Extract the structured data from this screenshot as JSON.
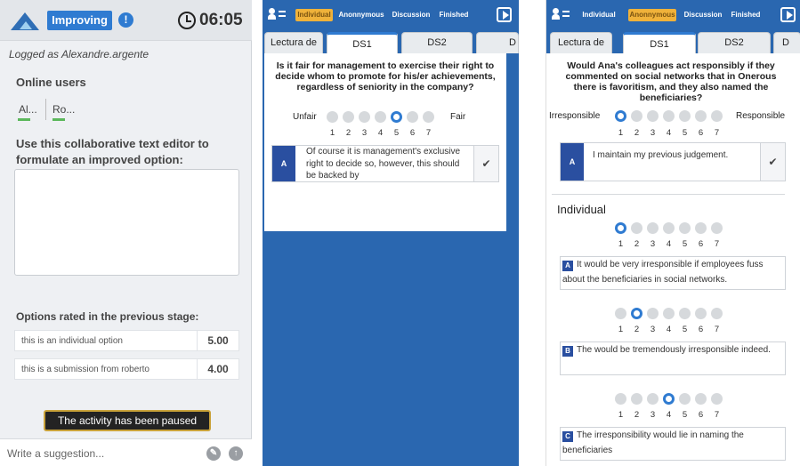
{
  "panel1": {
    "status_badge": "Improving",
    "info_glyph": "!",
    "timer": "06:05",
    "logged_as": "Logged as Alexandre.argente",
    "online_users_title": "Online users",
    "online_users": [
      "Al...",
      "Ro..."
    ],
    "editor_label": "Use this collaborative text editor to formulate an improved option:",
    "editor_value": "",
    "options_title": "Options rated in the previous stage:",
    "options": [
      {
        "text": "this is an individual option",
        "score": "5.00"
      },
      {
        "text": "this is a submission from roberto",
        "score": "4.00"
      }
    ],
    "paused_message": "The activity has been paused",
    "suggestion_placeholder": "Write a suggestion...",
    "icons": [
      "logo-icon",
      "info-icon",
      "clock-icon",
      "pencil-icon",
      "up-arrow-icon"
    ],
    "colors": {
      "accent": "#2f7bd1",
      "online": "#5cb85c",
      "paused_border": "#c9a23a"
    }
  },
  "panel2": {
    "topbar_tabs": [
      "Individual",
      "Anonnymous",
      "Discussion",
      "Finished"
    ],
    "active_tab_index": 0,
    "doc_tabs": [
      "Lectura de",
      "DS1",
      "DS2",
      "D"
    ],
    "active_doc_tab": 1,
    "question": "Is it fair for management to exercise their right to decide whom to promote for his/er achievements, regardless of seniority in the company?",
    "scale_left": "Unfair",
    "scale_right": "Fair",
    "scale_numbers": [
      "1",
      "2",
      "3",
      "4",
      "5",
      "6",
      "7"
    ],
    "selected_rating": 5,
    "answer_letter": "A",
    "answer_text": "Of course it is management's exclusive right to decide so, however, this should be backed by",
    "check_glyph": "✔",
    "colors": {
      "topbar": "#2a67b0",
      "active_tab": "#f0b23a",
      "answer_tag": "#2a4fa0"
    }
  },
  "panel3": {
    "topbar_tabs": [
      "Individual",
      "Anonnymous",
      "Discussion",
      "Finished"
    ],
    "active_tab_index": 1,
    "doc_tabs": [
      "Lectura de",
      "DS1",
      "DS2",
      "D"
    ],
    "active_doc_tab": 1,
    "question": "Would Ana's colleagues act responsibly if they commented on social networks that in Onerous there is favoritism, and they also named the beneficiaries?",
    "scale_left": "Irresponsible",
    "scale_right": "Responsible",
    "scale_numbers": [
      "1",
      "2",
      "3",
      "4",
      "5",
      "6",
      "7"
    ],
    "selected_rating": 1,
    "answer_letter": "A",
    "answer_text": "I maintain my previous judgement.",
    "check_glyph": "✔",
    "individual_title": "Individual",
    "individual_items": [
      {
        "rating": 1,
        "letter": "A",
        "text": "It would be very irresponsible if employees fuss about the beneficiaries in social networks."
      },
      {
        "rating": 2,
        "letter": "B",
        "text": "The would be tremendously irresponsible indeed."
      },
      {
        "rating": 4,
        "letter": "C",
        "text": "The irresponsibility would lie in naming the beneficiaries"
      }
    ]
  }
}
